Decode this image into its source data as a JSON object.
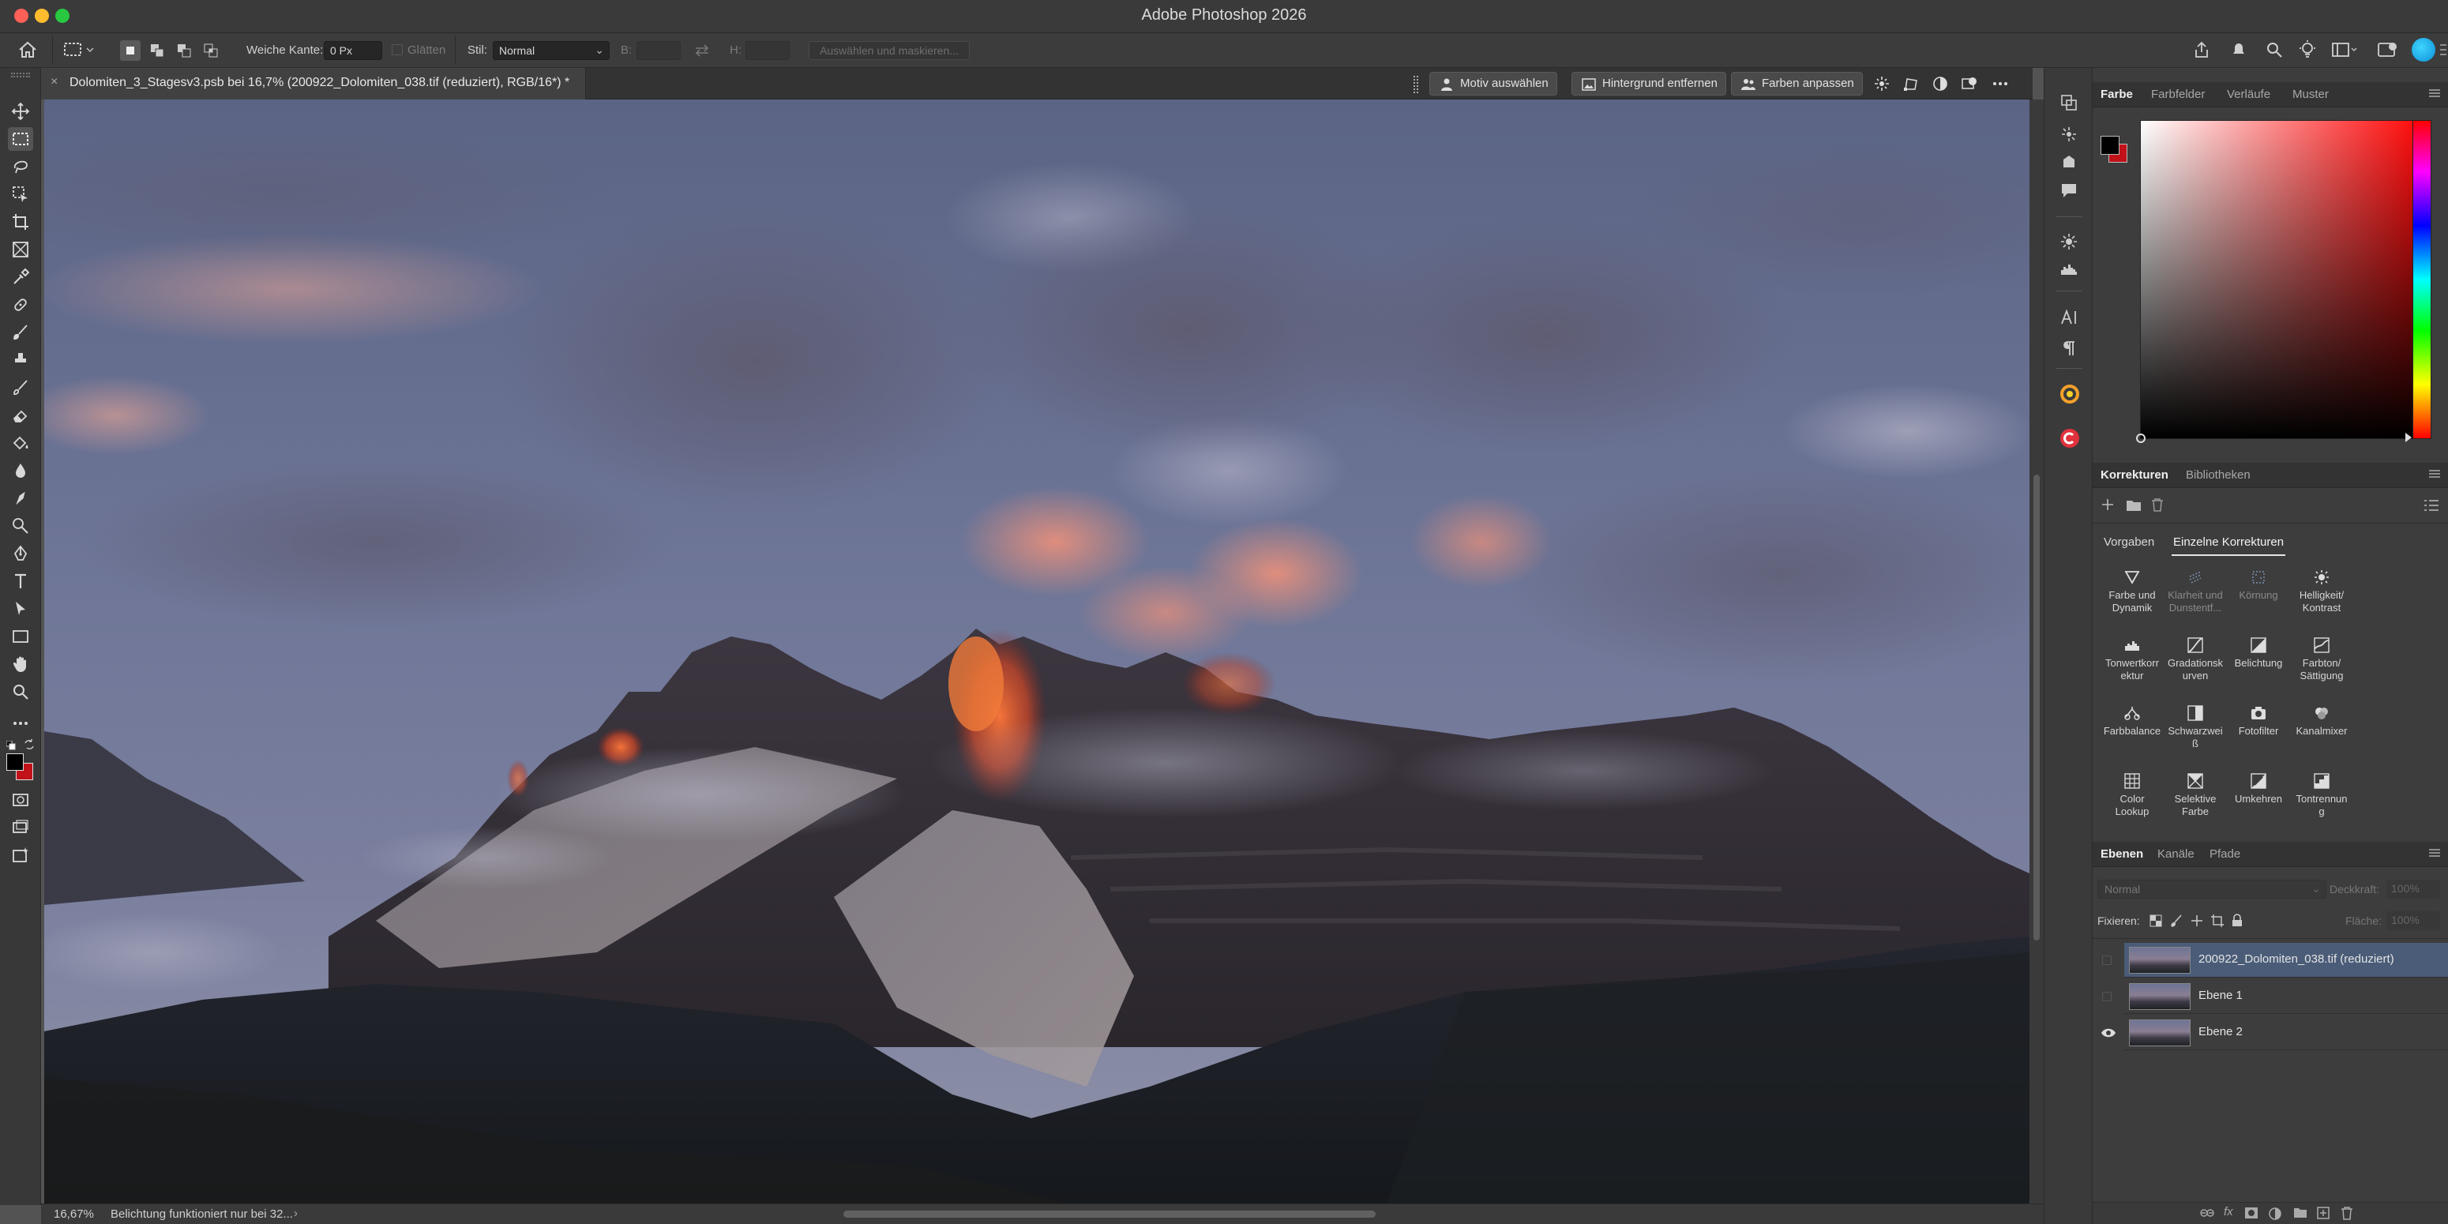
{
  "window": {
    "title": "Adobe Photoshop 2026"
  },
  "options_bar": {
    "feather_label": "Weiche Kante:",
    "feather_value": "0 Px",
    "antialias_label": "Glätten",
    "style_label": "Stil:",
    "style_value": "Normal",
    "width_label": "B:",
    "height_label": "H:",
    "select_mask_label": "Auswählen und maskieren..."
  },
  "document": {
    "tab_title": "Dolomiten_3_Stagesv3.psb bei 16,7% (200922_Dolomiten_038.tif (reduziert), RGB/16*) *",
    "zoom": "16,67%",
    "status": "Belichtung funktioniert nur bei 32..."
  },
  "contextual_taskbar": {
    "select_subject": "Motiv auswählen",
    "remove_background": "Hintergrund entfernen",
    "match_colors": "Farben anpassen"
  },
  "color_panel": {
    "tabs": [
      "Farbe",
      "Farbfelder",
      "Verläufe",
      "Muster"
    ],
    "active_tab": "Farbe",
    "foreground": "#000000",
    "background": "#c1121a",
    "hue_color": "#ff0000"
  },
  "adjustments_panel": {
    "tabs": [
      "Korrekturen",
      "Bibliotheken"
    ],
    "subtabs": [
      "Vorgaben",
      "Einzelne Korrekturen"
    ],
    "active_subtab": "Einzelne Korrekturen",
    "items": [
      {
        "line1": "Farbe und",
        "line2": "Dynamik",
        "icon": "vibrance-icon",
        "dim": false
      },
      {
        "line1": "Klarheit und",
        "line2": "Dunstentf...",
        "icon": "clarity-icon",
        "dim": true
      },
      {
        "line1": "Körnung",
        "line2": "",
        "icon": "grain-icon",
        "dim": true
      },
      {
        "line1": "Helligkeit/",
        "line2": "Kontrast",
        "icon": "brightness-icon",
        "dim": false
      },
      {
        "line1": "Tonwertkorr",
        "line2": "ektur",
        "icon": "levels-icon",
        "dim": false
      },
      {
        "line1": "Gradationsk",
        "line2": "urven",
        "icon": "curves-icon",
        "dim": false
      },
      {
        "line1": "Belichtung",
        "line2": "",
        "icon": "exposure-icon",
        "dim": false
      },
      {
        "line1": "Farbton/",
        "line2": "Sättigung",
        "icon": "hue-saturation-icon",
        "dim": false
      },
      {
        "line1": "Farbbalance",
        "line2": "",
        "icon": "color-balance-icon",
        "dim": false
      },
      {
        "line1": "Schwarzwei",
        "line2": "ß",
        "icon": "black-white-icon",
        "dim": false
      },
      {
        "line1": "Fotofilter",
        "line2": "",
        "icon": "photo-filter-icon",
        "dim": false
      },
      {
        "line1": "Kanalmixer",
        "line2": "",
        "icon": "channel-mixer-icon",
        "dim": false
      },
      {
        "line1": "Color",
        "line2": "Lookup",
        "icon": "color-lookup-icon",
        "dim": false
      },
      {
        "line1": "Selektive",
        "line2": "Farbe",
        "icon": "selective-color-icon",
        "dim": false
      },
      {
        "line1": "Umkehren",
        "line2": "",
        "icon": "invert-icon",
        "dim": false
      },
      {
        "line1": "Tontrennun",
        "line2": "g",
        "icon": "posterize-icon",
        "dim": false
      }
    ]
  },
  "layers_panel": {
    "tabs": [
      "Ebenen",
      "Kanäle",
      "Pfade"
    ],
    "active_tab": "Ebenen",
    "blend_mode": "Normal",
    "opacity_label": "Deckkraft:",
    "opacity_value": "100%",
    "lock_label": "Fixieren:",
    "fill_label": "Fläche:",
    "fill_value": "100%",
    "layers": [
      {
        "name": "200922_Dolomiten_038.tif (reduziert)",
        "visible": false,
        "selected": true
      },
      {
        "name": "Ebene 1",
        "visible": false,
        "selected": false
      },
      {
        "name": "Ebene 2",
        "visible": true,
        "selected": false
      }
    ]
  }
}
